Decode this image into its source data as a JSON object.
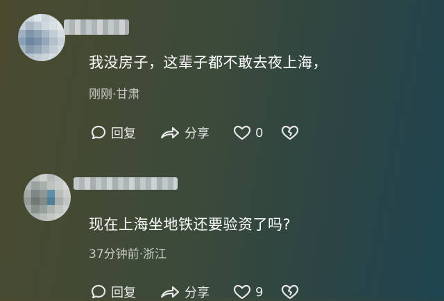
{
  "comments": [
    {
      "text": "我没房子，这辈子都不敢去夜上海，",
      "meta": "刚刚·甘肃",
      "reply_label": "回复",
      "share_label": "分享",
      "like_count": "0"
    },
    {
      "text": "现在上海坐地铁还要验资了吗?",
      "meta": "37分钟前·浙江",
      "reply_label": "回复",
      "share_label": "分享",
      "like_count": "9"
    }
  ],
  "icons": [
    "comment-bubble-icon",
    "share-arrow-icon",
    "heart-icon",
    "broken-heart-icon"
  ],
  "colors": {
    "text": "#ffffff",
    "meta": "#c8cbc7",
    "background_start": "#4a4a2e",
    "background_end": "#1f4550"
  }
}
